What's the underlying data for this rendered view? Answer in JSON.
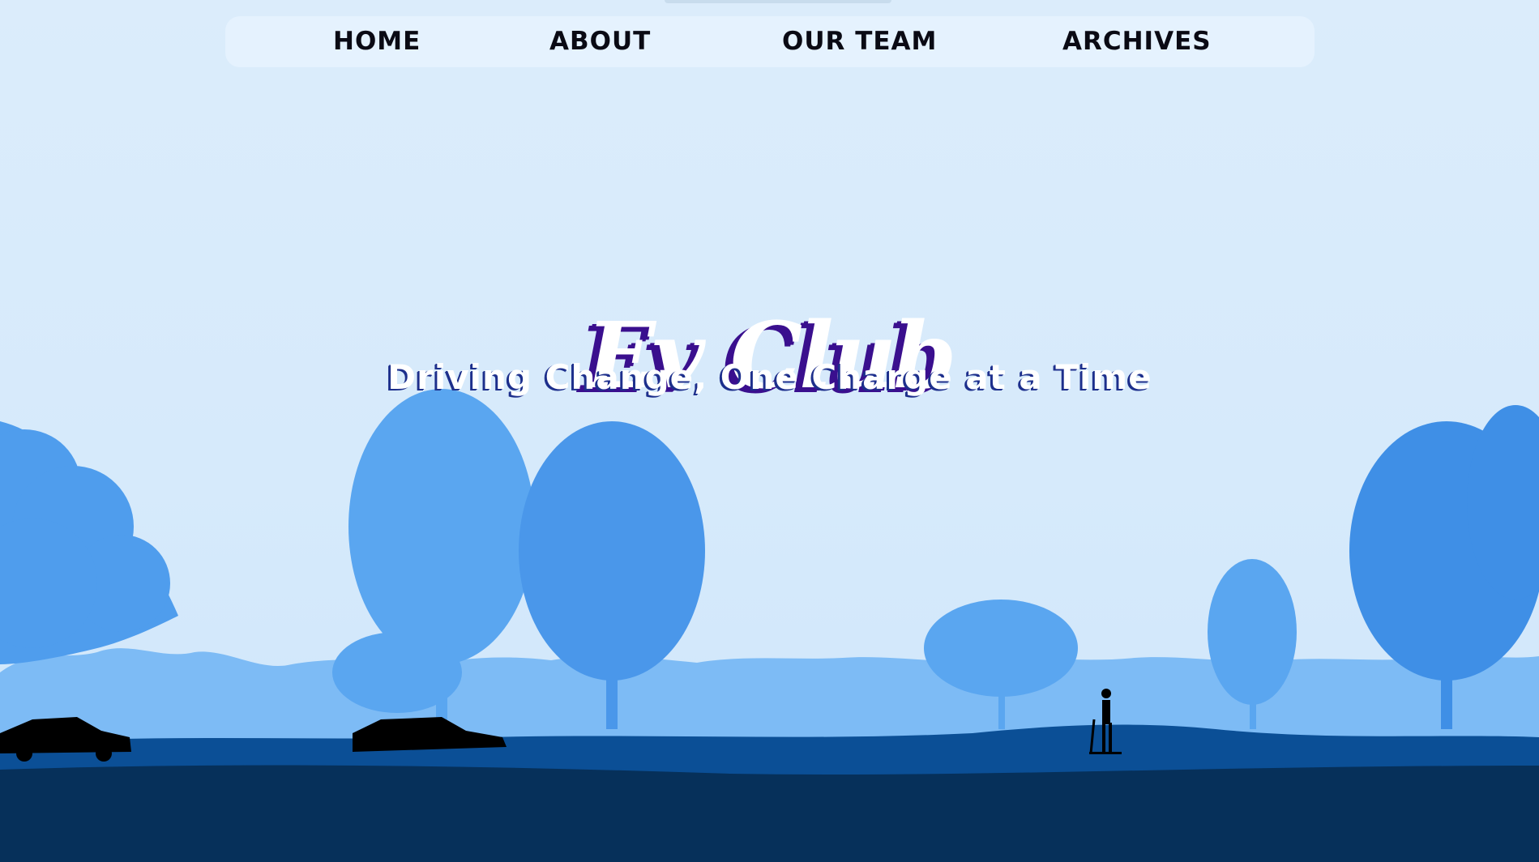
{
  "nav": {
    "items": [
      {
        "label": "HOME"
      },
      {
        "label": "ABOUT"
      },
      {
        "label": "OUR TEAM"
      },
      {
        "label": "ARCHIVES"
      }
    ]
  },
  "hero": {
    "title": "Ev Club",
    "tagline": "Driving Change, One Charge at a Time"
  },
  "colors": {
    "sky": "#d7ebfb",
    "navbar": "#e5f2fe",
    "title_shadow": "#3a0f8e",
    "tagline_shadow": "#1d2f8c",
    "tree_light": "#5aa6f0",
    "tree_mid": "#2f7fe0",
    "ground_dark": "#06305a"
  },
  "icons": [
    "car-silhouette-icon",
    "person-on-scooter-icon"
  ]
}
